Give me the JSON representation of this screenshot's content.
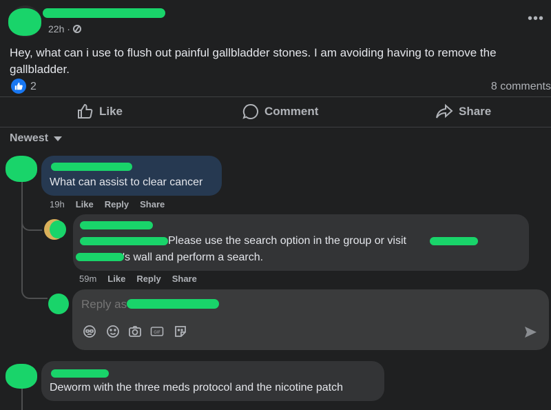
{
  "post": {
    "time": "22h ·",
    "text": "Hey, what can i use to flush out painful gallbladder stones. I am avoiding having to remove the gallbladder.",
    "reaction_count": "2",
    "comments_count": "8 comments",
    "actions": {
      "like": "Like",
      "comment": "Comment",
      "share": "Share"
    }
  },
  "sort_label": "Newest",
  "comments": [
    {
      "text": "What can assist to clear cancer",
      "time": "19h",
      "like": "Like",
      "reply": "Reply",
      "share": "Share",
      "replies": [
        {
          "text_line1": "Please use the search option in the group or visit",
          "text_line2": "'s wall and perform a search.",
          "time": "59m",
          "like": "Like",
          "reply": "Reply",
          "share": "Share"
        }
      ]
    },
    {
      "text": "Deworm with the three meds protocol and the nicotine patch"
    }
  ],
  "reply_box": {
    "placeholder": "Reply as"
  },
  "icons": [
    "globe-icon",
    "more-icon",
    "like-reaction-icon",
    "like-icon",
    "comment-icon",
    "share-icon",
    "caret-down-icon",
    "avatar-sticker-icon",
    "emoji-icon",
    "camera-icon",
    "gif-icon",
    "sticker-icon",
    "send-icon"
  ],
  "colors": {
    "background": "#1f2021",
    "bubble": "#333436",
    "highlight_bubble": "#263951",
    "accent": "#1877f2",
    "redaction": "#19d46a"
  }
}
